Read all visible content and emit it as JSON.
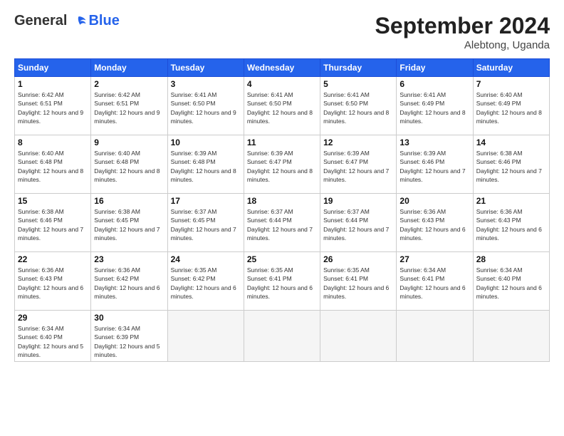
{
  "header": {
    "logo_general": "General",
    "logo_blue": "Blue",
    "month_title": "September 2024",
    "location": "Alebtong, Uganda"
  },
  "weekdays": [
    "Sunday",
    "Monday",
    "Tuesday",
    "Wednesday",
    "Thursday",
    "Friday",
    "Saturday"
  ],
  "weeks": [
    [
      {
        "day": "1",
        "sunrise": "6:42 AM",
        "sunset": "6:51 PM",
        "daylight": "12 hours and 9 minutes."
      },
      {
        "day": "2",
        "sunrise": "6:42 AM",
        "sunset": "6:51 PM",
        "daylight": "12 hours and 9 minutes."
      },
      {
        "day": "3",
        "sunrise": "6:41 AM",
        "sunset": "6:50 PM",
        "daylight": "12 hours and 9 minutes."
      },
      {
        "day": "4",
        "sunrise": "6:41 AM",
        "sunset": "6:50 PM",
        "daylight": "12 hours and 8 minutes."
      },
      {
        "day": "5",
        "sunrise": "6:41 AM",
        "sunset": "6:50 PM",
        "daylight": "12 hours and 8 minutes."
      },
      {
        "day": "6",
        "sunrise": "6:41 AM",
        "sunset": "6:49 PM",
        "daylight": "12 hours and 8 minutes."
      },
      {
        "day": "7",
        "sunrise": "6:40 AM",
        "sunset": "6:49 PM",
        "daylight": "12 hours and 8 minutes."
      }
    ],
    [
      {
        "day": "8",
        "sunrise": "6:40 AM",
        "sunset": "6:48 PM",
        "daylight": "12 hours and 8 minutes."
      },
      {
        "day": "9",
        "sunrise": "6:40 AM",
        "sunset": "6:48 PM",
        "daylight": "12 hours and 8 minutes."
      },
      {
        "day": "10",
        "sunrise": "6:39 AM",
        "sunset": "6:48 PM",
        "daylight": "12 hours and 8 minutes."
      },
      {
        "day": "11",
        "sunrise": "6:39 AM",
        "sunset": "6:47 PM",
        "daylight": "12 hours and 8 minutes."
      },
      {
        "day": "12",
        "sunrise": "6:39 AM",
        "sunset": "6:47 PM",
        "daylight": "12 hours and 7 minutes."
      },
      {
        "day": "13",
        "sunrise": "6:39 AM",
        "sunset": "6:46 PM",
        "daylight": "12 hours and 7 minutes."
      },
      {
        "day": "14",
        "sunrise": "6:38 AM",
        "sunset": "6:46 PM",
        "daylight": "12 hours and 7 minutes."
      }
    ],
    [
      {
        "day": "15",
        "sunrise": "6:38 AM",
        "sunset": "6:46 PM",
        "daylight": "12 hours and 7 minutes."
      },
      {
        "day": "16",
        "sunrise": "6:38 AM",
        "sunset": "6:45 PM",
        "daylight": "12 hours and 7 minutes."
      },
      {
        "day": "17",
        "sunrise": "6:37 AM",
        "sunset": "6:45 PM",
        "daylight": "12 hours and 7 minutes."
      },
      {
        "day": "18",
        "sunrise": "6:37 AM",
        "sunset": "6:44 PM",
        "daylight": "12 hours and 7 minutes."
      },
      {
        "day": "19",
        "sunrise": "6:37 AM",
        "sunset": "6:44 PM",
        "daylight": "12 hours and 7 minutes."
      },
      {
        "day": "20",
        "sunrise": "6:36 AM",
        "sunset": "6:43 PM",
        "daylight": "12 hours and 6 minutes."
      },
      {
        "day": "21",
        "sunrise": "6:36 AM",
        "sunset": "6:43 PM",
        "daylight": "12 hours and 6 minutes."
      }
    ],
    [
      {
        "day": "22",
        "sunrise": "6:36 AM",
        "sunset": "6:43 PM",
        "daylight": "12 hours and 6 minutes."
      },
      {
        "day": "23",
        "sunrise": "6:36 AM",
        "sunset": "6:42 PM",
        "daylight": "12 hours and 6 minutes."
      },
      {
        "day": "24",
        "sunrise": "6:35 AM",
        "sunset": "6:42 PM",
        "daylight": "12 hours and 6 minutes."
      },
      {
        "day": "25",
        "sunrise": "6:35 AM",
        "sunset": "6:41 PM",
        "daylight": "12 hours and 6 minutes."
      },
      {
        "day": "26",
        "sunrise": "6:35 AM",
        "sunset": "6:41 PM",
        "daylight": "12 hours and 6 minutes."
      },
      {
        "day": "27",
        "sunrise": "6:34 AM",
        "sunset": "6:41 PM",
        "daylight": "12 hours and 6 minutes."
      },
      {
        "day": "28",
        "sunrise": "6:34 AM",
        "sunset": "6:40 PM",
        "daylight": "12 hours and 6 minutes."
      }
    ],
    [
      {
        "day": "29",
        "sunrise": "6:34 AM",
        "sunset": "6:40 PM",
        "daylight": "12 hours and 5 minutes."
      },
      {
        "day": "30",
        "sunrise": "6:34 AM",
        "sunset": "6:39 PM",
        "daylight": "12 hours and 5 minutes."
      },
      null,
      null,
      null,
      null,
      null
    ]
  ]
}
